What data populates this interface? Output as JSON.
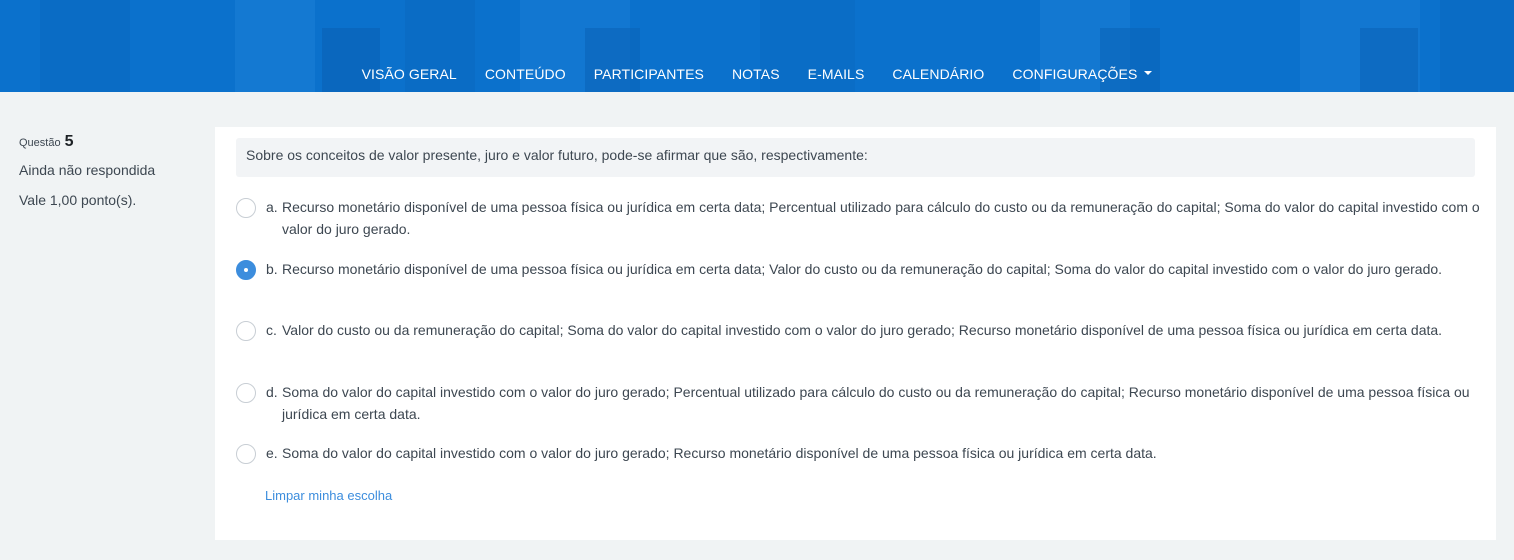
{
  "nav": {
    "items": [
      "VISÃO GERAL",
      "CONTEÚDO",
      "PARTICIPANTES",
      "NOTAS",
      "E-MAILS",
      "CALENDÁRIO",
      "CONFIGURAÇÕES"
    ],
    "colors": {
      "header": "#0b71cc",
      "text": "#ffffff"
    }
  },
  "question": {
    "label": "Questão",
    "number": "5",
    "state": "Ainda não respondida",
    "grade": "Vale 1,00 ponto(s).",
    "text": "Sobre os conceitos de valor presente, juro e valor futuro, pode-se afirmar que são, respectivamente:",
    "selected": "b",
    "answers": [
      {
        "letter": "a.",
        "text": "Recurso monetário disponível de uma pessoa física ou jurídica em certa data; Percentual utilizado para cálculo do custo ou da remuneração do capital; Soma do valor do capital investido com o valor do juro gerado."
      },
      {
        "letter": "b.",
        "text": "Recurso monetário disponível de uma pessoa física ou jurídica em certa data; Valor do custo ou da remuneração do capital; Soma do valor do capital investido com o valor do juro gerado."
      },
      {
        "letter": "c.",
        "text": "Valor do custo ou da remuneração do capital; Soma do valor do capital investido com o valor do juro gerado; Recurso monetário disponível de uma pessoa física ou jurídica em certa data."
      },
      {
        "letter": "d.",
        "text": "Soma do valor do capital investido com o valor do juro gerado; Percentual utilizado para cálculo do custo ou da remuneração do capital; Recurso monetário disponível de uma pessoa física ou jurídica em certa data."
      },
      {
        "letter": "e.",
        "text": "Soma do valor do capital investido com o valor do juro gerado; Recurso monetário disponível de uma pessoa física ou jurídica em certa data."
      }
    ],
    "clear_label": "Limpar minha escolha",
    "accent": "#3c8ddd"
  }
}
